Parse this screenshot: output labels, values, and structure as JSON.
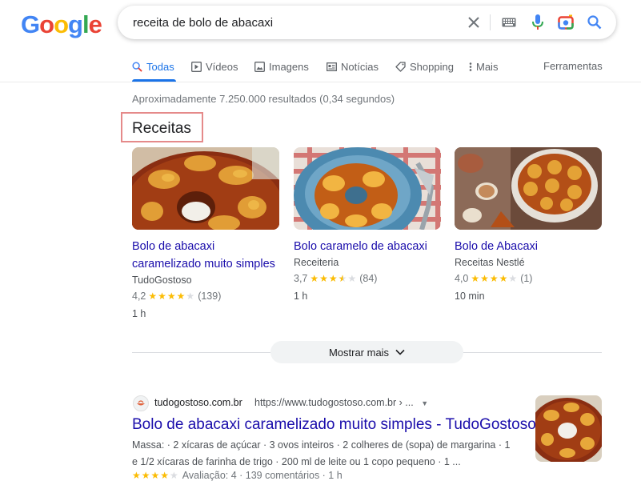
{
  "logo": {
    "letters": [
      "G",
      "o",
      "o",
      "g",
      "l",
      "e"
    ],
    "colors": [
      "#4285f4",
      "#ea4335",
      "#fbbc05",
      "#4285f4",
      "#34a853",
      "#ea4335"
    ]
  },
  "search": {
    "query": "receita de bolo de abacaxi"
  },
  "tabs": [
    {
      "label": "Todas",
      "icon": "search-icon"
    },
    {
      "label": "Vídeos",
      "icon": "play-icon"
    },
    {
      "label": "Imagens",
      "icon": "image-icon"
    },
    {
      "label": "Notícias",
      "icon": "news-icon"
    },
    {
      "label": "Shopping",
      "icon": "tag-icon"
    },
    {
      "label": "Mais",
      "icon": "more-vert-icon"
    }
  ],
  "tools_label": "Ferramentas",
  "stats": "Aproximadamente 7.250.000 resultados (0,34 segundos)",
  "recipes": {
    "title": "Receitas",
    "cards": [
      {
        "title": "Bolo de abacaxi caramelizado muito simples",
        "source": "TudoGostoso",
        "rating": "4,2",
        "stars": 4,
        "count": "(139)",
        "time": "1 h"
      },
      {
        "title": "Bolo caramelo de abacaxi",
        "source": "Receiteria",
        "rating": "3,7",
        "stars": 3.5,
        "count": "(84)",
        "time": "1 h"
      },
      {
        "title": "Bolo de Abacaxi",
        "source": "Receitas Nestlé",
        "rating": "4,0",
        "stars": 4,
        "count": "(1)",
        "time": "10 min"
      }
    ],
    "more_label": "Mostrar mais"
  },
  "result": {
    "site": "tudogostoso.com.br",
    "url": "https://www.tudogostoso.com.br › ...",
    "title": "Bolo de abacaxi caramelizado muito simples - TudoGostoso",
    "snippet": "Massa: · 2 xícaras de açúcar · 3 ovos inteiros · 2 colheres de (sopa) de margarina · 1 e 1/2 xícaras de farinha de trigo · 200 ml de leite ou 1 copo pequeno · 1 ...",
    "rating_text": "Avaliação: 4 · 139 comentários · 1 h",
    "stars": 4
  },
  "colors": {
    "link": "#1a0dab",
    "accent": "#1a73e8",
    "star": "#fbbc04"
  }
}
